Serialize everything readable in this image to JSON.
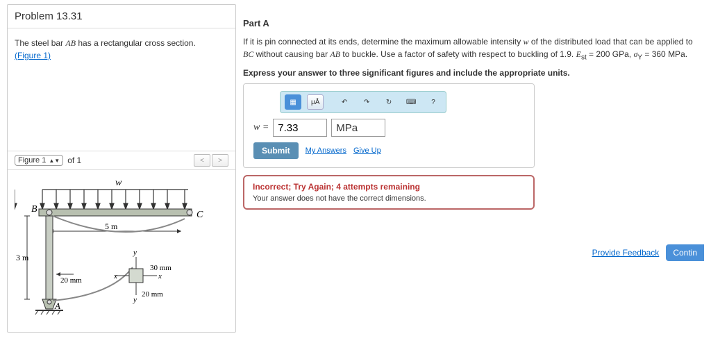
{
  "problem": {
    "number": "Problem 13.31",
    "desc_prefix": "The steel bar ",
    "desc_bar": "AB",
    "desc_suffix": " has a rectangular cross section.",
    "figure_link": "(Figure 1)"
  },
  "figure_bar": {
    "selected": "Figure 1",
    "of_label": "of 1"
  },
  "figure": {
    "w": "w",
    "B": "B",
    "C": "C",
    "A": "A",
    "len_bc": "5 m",
    "len_ab": "3 m",
    "t20": "20 mm",
    "t30": "30 mm",
    "x": "x",
    "y": "y"
  },
  "partA": {
    "title": "Part A",
    "prompt1_a": "If it is pin connected at its ends, determine the maximum allowable intensity ",
    "prompt1_w": "w",
    "prompt1_b": " of the distributed load that can be applied to ",
    "prompt1_bc": "BC",
    "prompt1_c": " without causing bar ",
    "prompt1_ab": "AB",
    "prompt1_d": " to buckle. Use a factor of safety with respect to buckling of 1.9. ",
    "Est_label": "E",
    "Est_sub": "st",
    "Est_val": " = 200 GPa, ",
    "sigY_label": "σ",
    "sigY_sub": "Y",
    "sigY_val": " = 360 MPa.",
    "prompt2": "Express your answer to three significant figures and include the appropriate units."
  },
  "toolbar": {
    "template": "▦",
    "units": "μÅ",
    "undo": "↶",
    "redo": "↷",
    "reset": "↻",
    "keyboard": "⌨",
    "help": "?"
  },
  "answer": {
    "var": "w",
    "eq": " = ",
    "value": "7.33",
    "unit": "MPa"
  },
  "actions": {
    "submit": "Submit",
    "my_answers": "My Answers",
    "give_up": "Give Up"
  },
  "feedback": {
    "title": "Incorrect; Try Again; 4 attempts remaining",
    "msg": "Your answer does not have the correct dimensions."
  },
  "footer": {
    "provide": "Provide Feedback",
    "continue": "Contin"
  }
}
